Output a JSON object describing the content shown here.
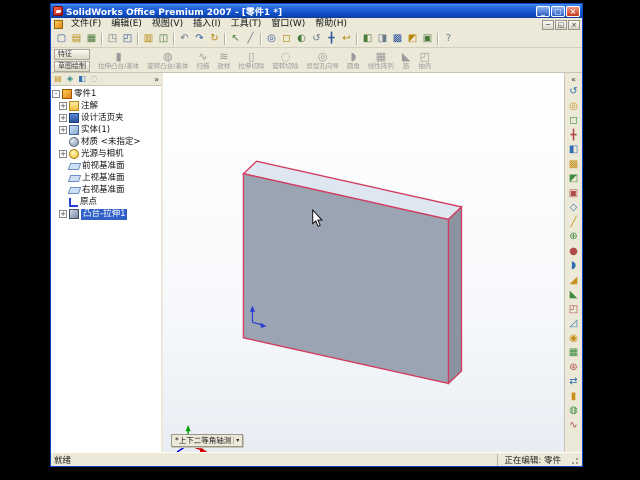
{
  "window": {
    "title": "SolidWorks Office Premium 2007 - [零件1 *]",
    "controls": [
      {
        "name": "minimize",
        "glyph": "_"
      },
      {
        "name": "maximize",
        "glyph": "▢"
      },
      {
        "name": "close",
        "glyph": "×"
      }
    ],
    "mdi_controls": [
      {
        "name": "mdi-minimize",
        "glyph": "─"
      },
      {
        "name": "mdi-restore",
        "glyph": "◱"
      },
      {
        "name": "mdi-close",
        "glyph": "×"
      }
    ]
  },
  "menu": {
    "items": [
      "文件(F)",
      "编辑(E)",
      "视图(V)",
      "插入(I)",
      "工具(T)",
      "窗口(W)",
      "帮助(H)"
    ]
  },
  "standard_toolbar": {
    "icons": [
      {
        "name": "new",
        "glyph": "▢"
      },
      {
        "name": "open",
        "glyph": "▤"
      },
      {
        "name": "save",
        "glyph": "▦"
      },
      {
        "name": "make-drawing",
        "glyph": "◳"
      },
      {
        "name": "make-assembly",
        "glyph": "◰"
      },
      {
        "name": "print",
        "glyph": "▥"
      },
      {
        "name": "print-preview",
        "glyph": "◫"
      },
      {
        "name": "undo",
        "glyph": "↶"
      },
      {
        "name": "redo",
        "glyph": "↷"
      },
      {
        "name": "rebuild",
        "glyph": "↻"
      },
      {
        "name": "select",
        "glyph": "↖"
      },
      {
        "name": "sketch",
        "glyph": "╱"
      },
      {
        "name": "zoom-fit",
        "glyph": "◎"
      },
      {
        "name": "zoom-area",
        "glyph": "◻"
      },
      {
        "name": "zoom-in-out",
        "glyph": "◐"
      },
      {
        "name": "rotate-view",
        "glyph": "↺"
      },
      {
        "name": "pan",
        "glyph": "╋"
      },
      {
        "name": "previous-view",
        "glyph": "↩"
      },
      {
        "name": "shaded",
        "glyph": "◧"
      },
      {
        "name": "hidden-lines",
        "glyph": "◨"
      },
      {
        "name": "wireframe",
        "glyph": "▩"
      },
      {
        "name": "section-view",
        "glyph": "◩"
      },
      {
        "name": "view-orientation",
        "glyph": "▣"
      },
      {
        "name": "help",
        "glyph": "?"
      }
    ]
  },
  "command_manager": {
    "tabs": [
      "特征",
      "草图绘制"
    ],
    "buttons": [
      {
        "name": "extrude-boss",
        "glyph": "▮",
        "label": "拉伸凸台/基体"
      },
      {
        "name": "revolve-boss",
        "glyph": "◍",
        "label": "旋转凸台/基体"
      },
      {
        "name": "sweep",
        "glyph": "∿",
        "label": "扫描"
      },
      {
        "name": "loft",
        "glyph": "≋",
        "label": "放样"
      },
      {
        "name": "extrude-cut",
        "glyph": "▯",
        "label": "拉伸切除"
      },
      {
        "name": "revolve-cut",
        "glyph": "◌",
        "label": "旋转切除"
      },
      {
        "name": "hole-wizard",
        "glyph": "◎",
        "label": "异型孔向导"
      },
      {
        "name": "fillet",
        "glyph": "◗",
        "label": "圆角"
      },
      {
        "name": "linear-pattern",
        "glyph": "▦",
        "label": "线性阵列"
      },
      {
        "name": "rib",
        "glyph": "◣",
        "label": "筋"
      },
      {
        "name": "shell",
        "glyph": "◰",
        "label": "抽壳"
      }
    ]
  },
  "feature_tree": {
    "collapse_chevron": "»",
    "tabs": [
      "feature-manager",
      "property-manager",
      "configuration-manager",
      "third-party"
    ],
    "items": [
      {
        "label": "零件1",
        "icon": "part",
        "expander": "-"
      },
      {
        "label": "注解",
        "icon": "annotations-folder",
        "expander": "+"
      },
      {
        "label": "设计活页夹",
        "icon": "design-binder",
        "expander": "+"
      },
      {
        "label": "实体(1)",
        "icon": "solid-bodies-folder",
        "expander": "+"
      },
      {
        "label": "材质 <未指定>",
        "icon": "material"
      },
      {
        "label": "光源与相机",
        "icon": "lights-cameras",
        "expander": "+"
      },
      {
        "label": "前视基准面",
        "icon": "plane"
      },
      {
        "label": "上视基准面",
        "icon": "plane"
      },
      {
        "label": "右视基准面",
        "icon": "plane"
      },
      {
        "label": "原点",
        "icon": "origin"
      },
      {
        "label": "凸台-拉伸1",
        "icon": "extrude-feature",
        "expander": "+",
        "selected": true
      }
    ]
  },
  "viewport": {
    "orientation_label": "*上下二等角轴测",
    "orientation_dropdown_glyph": "▾",
    "part_face_color": "#9ba4b2",
    "part_top_color": "#dde6f1",
    "part_side_color": "#8b93a1",
    "highlight_edge_color": "#d23b5e",
    "triad_colors": {
      "x": "#d00000",
      "y": "#00a000",
      "z": "#0000d0"
    }
  },
  "right_toolbar": {
    "collapse_chevron": "«",
    "icons": [
      {
        "name": "rotate-view",
        "glyph": "↺"
      },
      {
        "name": "zoom-fit",
        "glyph": "◎"
      },
      {
        "name": "zoom-area",
        "glyph": "◻"
      },
      {
        "name": "pan",
        "glyph": "╋"
      },
      {
        "name": "shaded",
        "glyph": "◧"
      },
      {
        "name": "wireframe",
        "glyph": "▩"
      },
      {
        "name": "section-view",
        "glyph": "◩"
      },
      {
        "name": "view-orientation",
        "glyph": "▣"
      },
      {
        "name": "reference-plane",
        "glyph": "◇"
      },
      {
        "name": "reference-axis",
        "glyph": "╱"
      },
      {
        "name": "coordinate-system",
        "glyph": "⊕"
      },
      {
        "name": "reference-point",
        "glyph": "●"
      },
      {
        "name": "fillet",
        "glyph": "◗"
      },
      {
        "name": "chamfer",
        "glyph": "◢"
      },
      {
        "name": "rib",
        "glyph": "◣"
      },
      {
        "name": "shell",
        "glyph": "◰"
      },
      {
        "name": "draft",
        "glyph": "◿"
      },
      {
        "name": "hole-wizard",
        "glyph": "◉"
      },
      {
        "name": "linear-pattern",
        "glyph": "▦"
      },
      {
        "name": "circular-pattern",
        "glyph": "⊛"
      },
      {
        "name": "mirror",
        "glyph": "⇄"
      },
      {
        "name": "extrude-boss",
        "glyph": "▮"
      },
      {
        "name": "revolve-boss",
        "glyph": "◍"
      },
      {
        "name": "sweep",
        "glyph": "∿"
      }
    ]
  },
  "status_bar": {
    "left": "就绪",
    "right": "正在编辑: 零件"
  }
}
